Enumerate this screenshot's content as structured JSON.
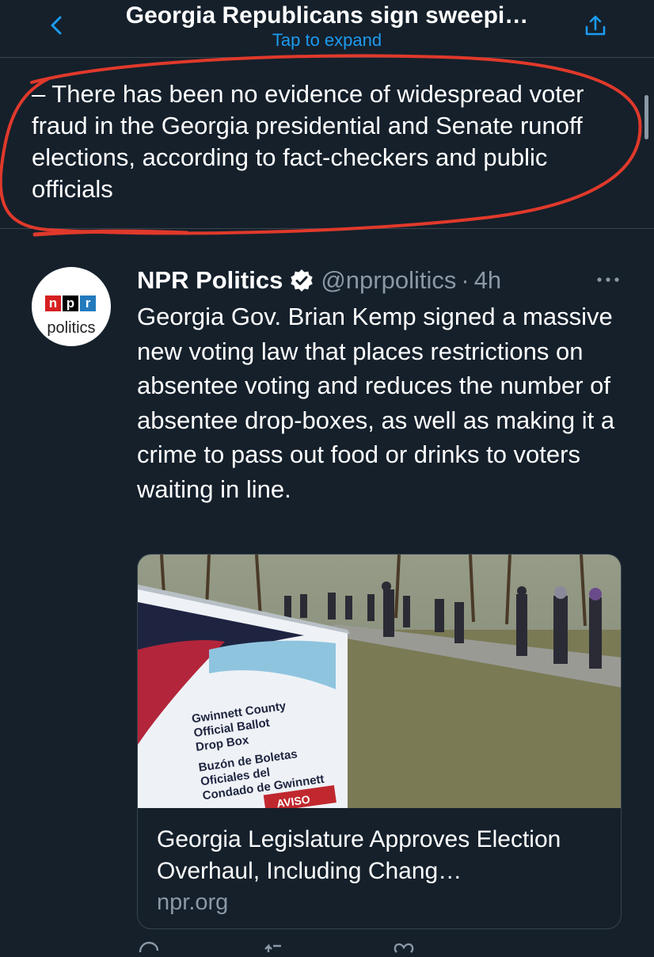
{
  "header": {
    "title": "Georgia Republicans sign sweepi…",
    "subtitle": "Tap to expand",
    "back_icon": "chevron-left-icon",
    "share_icon": "share-icon"
  },
  "notice": {
    "text": "– There has been no evidence of widespread voter fraud in the Georgia presidential and Senate runoff elections, according to fact-checkers and public officials"
  },
  "tweet": {
    "avatar_logo_letters": [
      "n",
      "p",
      "r"
    ],
    "avatar_word": "politics",
    "author": "NPR Politics",
    "verified_icon": "verified-badge-icon",
    "handle": "@nprpolitics",
    "separator": "·",
    "time": "4h",
    "more_icon": "more-horizontal-icon",
    "text": "Georgia Gov. Brian Kemp signed a massive new voting law that places restrictions on absentee voting and reduces the number of absentee drop-boxes, as well as making it a crime to pass out food or drinks to voters waiting in line.",
    "card": {
      "image_sign_lines": [
        "Gwinnett County",
        "Official Ballot",
        "Drop Box",
        "Buzón de Boletas",
        "Oficiales del",
        "Condado de Gwinnett"
      ],
      "image_sign_warning": "AVISO",
      "title": "Georgia Legislature Approves Election Overhaul, Including Chang…",
      "domain": "npr.org"
    }
  },
  "colors": {
    "background": "#15202b",
    "divider": "#38444d",
    "accent": "#1d9bf0",
    "secondary_text": "#8b98a5",
    "annotation_red": "#e0392b"
  }
}
